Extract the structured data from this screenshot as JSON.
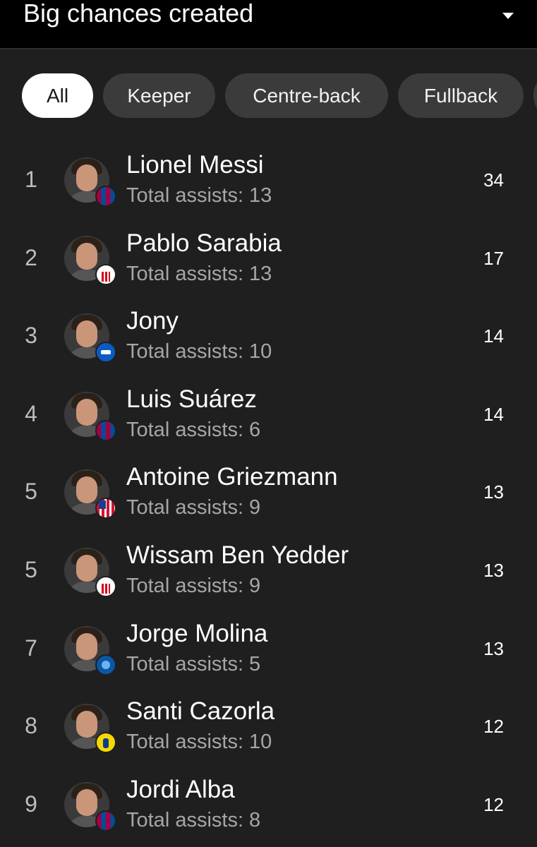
{
  "header": {
    "title": "Big chances created",
    "dropdown_icon": "caret-down-icon"
  },
  "filters": {
    "chips": [
      {
        "label": "All",
        "active": true
      },
      {
        "label": "Keeper",
        "active": false
      },
      {
        "label": "Centre-back",
        "active": false
      },
      {
        "label": "Fullback",
        "active": false
      },
      {
        "label": "",
        "active": false
      }
    ]
  },
  "players": [
    {
      "rank": "1",
      "name": "Lionel Messi",
      "sub": "Total assists: 13",
      "value": "34",
      "team_badge": "barcelona"
    },
    {
      "rank": "2",
      "name": "Pablo Sarabia",
      "sub": "Total assists: 13",
      "value": "17",
      "team_badge": "sevilla"
    },
    {
      "rank": "3",
      "name": "Jony",
      "sub": "Total assists: 10",
      "value": "14",
      "team_badge": "alaves"
    },
    {
      "rank": "4",
      "name": "Luis Suárez",
      "sub": "Total assists: 6",
      "value": "14",
      "team_badge": "barcelona"
    },
    {
      "rank": "5",
      "name": "Antoine Griezmann",
      "sub": "Total assists: 9",
      "value": "13",
      "team_badge": "atletico-madrid"
    },
    {
      "rank": "5",
      "name": "Wissam Ben Yedder",
      "sub": "Total assists: 9",
      "value": "13",
      "team_badge": "sevilla"
    },
    {
      "rank": "7",
      "name": "Jorge Molina",
      "sub": "Total assists: 5",
      "value": "13",
      "team_badge": "getafe"
    },
    {
      "rank": "8",
      "name": "Santi Cazorla",
      "sub": "Total assists: 10",
      "value": "12",
      "team_badge": "villarreal"
    },
    {
      "rank": "9",
      "name": "Jordi Alba",
      "sub": "Total assists: 8",
      "value": "12",
      "team_badge": "barcelona"
    }
  ],
  "colors": {
    "background": "#1f1f1f",
    "header_background": "#000000",
    "chip_inactive": "#3b3b3b",
    "chip_active": "#ffffff",
    "secondary_text": "#a6a6a6"
  }
}
